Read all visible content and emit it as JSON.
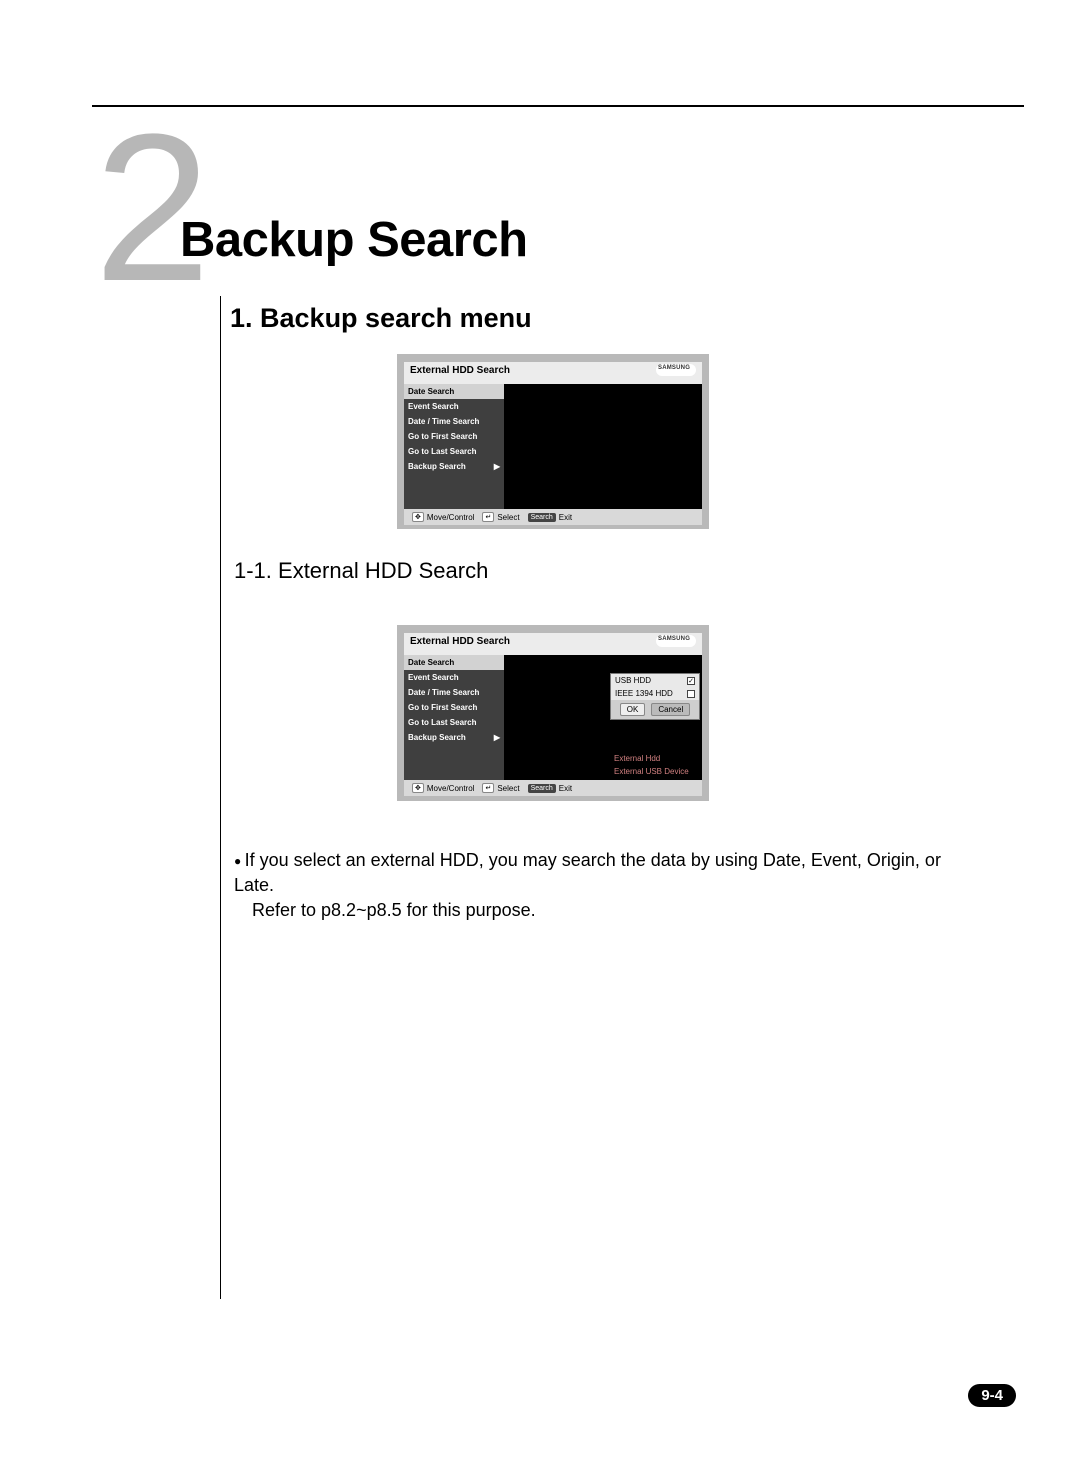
{
  "chapter": {
    "number": "2",
    "title": "Backup Search"
  },
  "section": {
    "heading": "1. Backup search menu",
    "subsection": "1-1. External HDD Search"
  },
  "shot_common": {
    "title": "External HDD Search",
    "brand": "SAMSUNG",
    "menu": {
      "items": [
        "Date  Search",
        "Event Search",
        "Date / Time Search",
        "Go to First Search",
        "Go to Last Search",
        "Backup  Search"
      ],
      "arrow": "▶"
    },
    "footer": {
      "move": "Move/Control",
      "select": "Select",
      "search_key": "Search",
      "exit": "Exit"
    }
  },
  "shot2_popup": {
    "rows": [
      {
        "label": "USB HDD",
        "checked": true
      },
      {
        "label": "IEEE 1394 HDD",
        "checked": false
      }
    ],
    "ok": "OK",
    "cancel": "Cancel",
    "subitems": [
      "External Hdd",
      "External USB Device"
    ]
  },
  "body": {
    "bullet": "If you select an external HDD, you may search the data by using Date, Event, Origin, or Late.",
    "refer": "Refer to p8.2~p8.5 for this purpose."
  },
  "page_num": "9-4"
}
